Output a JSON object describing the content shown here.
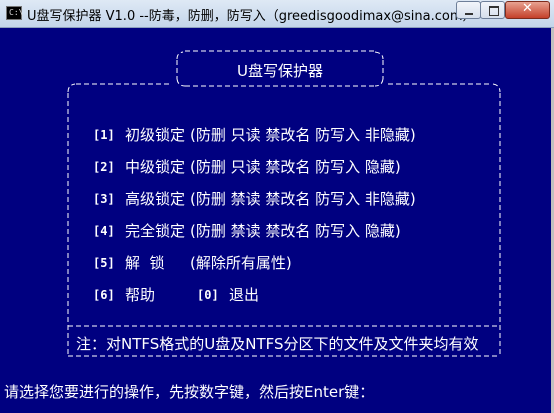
{
  "window": {
    "icon_label": "C:\\",
    "title": "U盘写保护器 V1.0  --防毒，防删，防写入（greedisgoodimax@sina.com）",
    "close_glyph": "✕"
  },
  "header": {
    "title": "U盘写保护器"
  },
  "menu": [
    {
      "key": "[1]",
      "name": "初级锁定",
      "attrs": "(防删   只读   禁改名   防写入   非隐藏)"
    },
    {
      "key": "[2]",
      "name": "中级锁定",
      "attrs": "(防删   只读   禁改名   防写入   隐藏)"
    },
    {
      "key": "[3]",
      "name": "高级锁定",
      "attrs": "(防删   禁读   禁改名   防写入   非隐藏)"
    },
    {
      "key": "[4]",
      "name": "完全锁定",
      "attrs": "(防删   禁读   禁改名   防写入   隐藏)"
    },
    {
      "key": "[5]",
      "name": "解  锁",
      "attrs": "(解除所有属性)"
    }
  ],
  "help": {
    "key": "[6]",
    "label": "帮助"
  },
  "exit": {
    "key": "[0]",
    "label": "退出"
  },
  "note": "注：对NTFS格式的U盘及NTFS分区下的文件及文件夹均有效",
  "prompt": "请选择您要进行的操作，先按数字键，然后按Enter键："
}
